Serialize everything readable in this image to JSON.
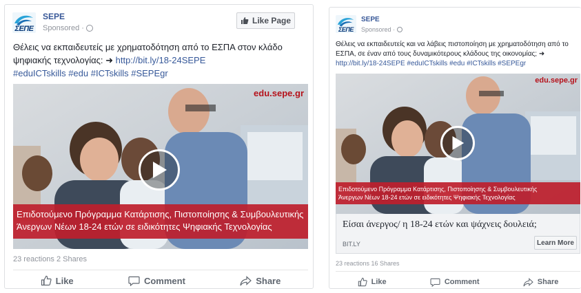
{
  "post_a": {
    "logo_text": "ΣΕΠΕ",
    "page_name": "SEPE",
    "sponsored": "Sponsored ·",
    "like_page_label": "Like Page",
    "body_line1": "Θέλεις να εκπαιδευτείς με χρηματοδότηση από το ΕΣΠΑ στον κλάδο",
    "body_line2_text": "ψηφιακής τεχνολογίας: ➜ ",
    "body_line2_link": "http://bit.ly/18-24SEPE",
    "body_line3": "#eduICTskills #edu #ICTskills #SEPEgr",
    "brand_url": "edu.sepe.gr",
    "banner_line1": "Επιδοτούμενο Πρόγραμμα Κατάρτισης, Πιστοποίησης & Συμβουλευτικής",
    "banner_line2": "Άνεργων Νέων 18-24 ετών σε ειδικότητες Ψηφιακής Τεχνολογίας",
    "stats": "23 reactions  2 Shares",
    "like": "Like",
    "comment": "Comment",
    "share": "Share"
  },
  "post_b": {
    "logo_text": "ΣΕΠΕ",
    "page_name": "SEPE",
    "sponsored": "Sponsored ·",
    "body_line1": "Θέλεις να εκπαιδευτείς και να λάβεις πιστοποίηση με χρηματοδότηση από το",
    "body_line2": "ΕΣΠΑ, σε έναν από τους δυναμικότερους κλάδους της οικονομίας; ➜",
    "body_line3": "http://bit.ly/18-24SEPE #eduICTskills #edu #ICTskills #SEPEgr",
    "brand_url": "edu.sepe.gr",
    "banner_line1": "Επιδοτούμενο Πρόγραμμα Κατάρτισης, Πιστοποίησης & Συμβουλευτικής",
    "banner_line2": "Άνεργων Νέων 18-24 ετών σε ειδικότητες Ψηφιακής Τεχνολογίας",
    "headline": "Είσαι άνεργος/ η 18-24 ετών και ψάχνεις δουλειά;",
    "domain": "BIT.LY",
    "learn_more": "Learn More",
    "stats": "23 reactions  16 Shares",
    "like": "Like",
    "comment": "Comment",
    "share": "Share"
  },
  "colors": {
    "link": "#365899",
    "page_name": "#385898",
    "banner_red": "#be1e2d",
    "brand_red": "#b5121b"
  },
  "icons": [
    "globe-icon",
    "thumbs-up-icon",
    "comment-icon",
    "share-icon",
    "play-icon"
  ]
}
